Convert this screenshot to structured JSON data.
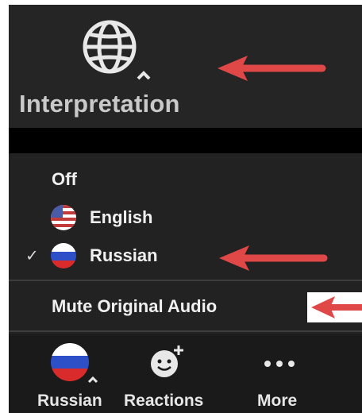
{
  "toolbar_top": {
    "interpretation_label": "Interpretation",
    "globe_icon": "globe-icon"
  },
  "menu": {
    "off_label": "Off",
    "english_label": "English",
    "russian_label": "Russian",
    "selected": "Russian",
    "mute_label": "Mute Original Audio"
  },
  "bottom_toolbar": {
    "language_label": "Russian",
    "reactions_label": "Reactions",
    "more_label": "More"
  },
  "colors": {
    "arrow": "#e04848",
    "panel": "#252525",
    "menu": "#222222",
    "text": "#f0f0f0"
  }
}
